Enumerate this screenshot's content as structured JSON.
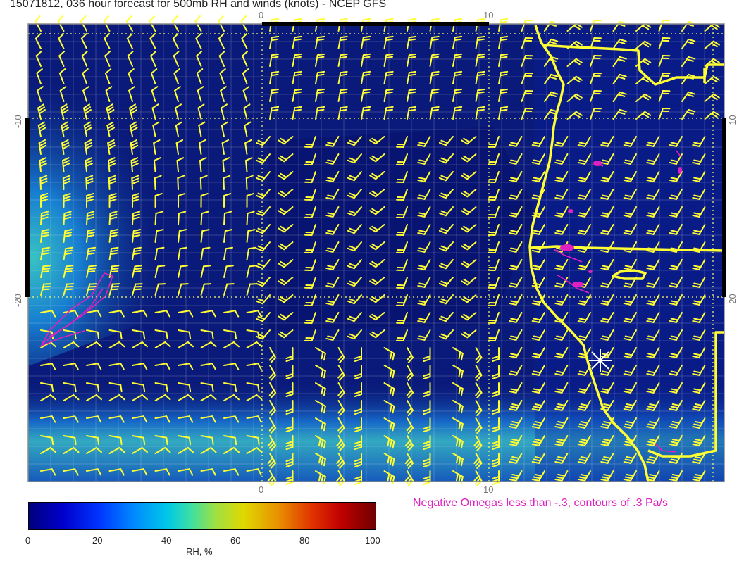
{
  "title": "15071812, 036 hour forecast for 500mb RH and winds (knots) - NCEP GFS",
  "axes": {
    "x_ticks": [
      "0",
      "10"
    ],
    "y_ticks": [
      "-10",
      "-20"
    ]
  },
  "annotation": "Negative Omegas less than -.3, contours of .3 Pa/s",
  "colorbar": {
    "title": "RH, %",
    "ticks": [
      "0",
      "20",
      "40",
      "60",
      "80",
      "100"
    ],
    "range": [
      0,
      100
    ]
  },
  "colors": {
    "background_rh": "#0a1a7a",
    "barbs": "#ffff33",
    "coastline": "#ffff33",
    "omega_contours": "#e020c0",
    "grid": "#ffffff"
  },
  "icons": [
    "wind-barb-icon",
    "station-star-icon"
  ]
}
